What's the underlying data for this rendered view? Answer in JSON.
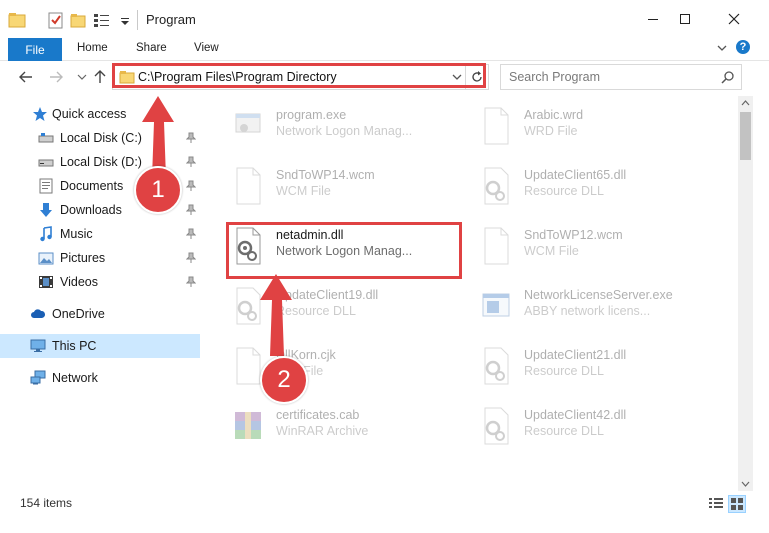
{
  "window": {
    "title": "Program"
  },
  "ribbon": {
    "tabs": [
      {
        "label": "File"
      },
      {
        "label": "Home"
      },
      {
        "label": "Share"
      },
      {
        "label": "View"
      }
    ]
  },
  "address": {
    "path": "C:\\Program Files\\Program Directory"
  },
  "search": {
    "placeholder": "Search Program"
  },
  "sidebar": {
    "items": [
      {
        "label": "Quick access",
        "icon": "star-icon"
      },
      {
        "label": "Local Disk (C:)",
        "icon": "drive-icon"
      },
      {
        "label": "Local Disk (D:)",
        "icon": "drive-icon"
      },
      {
        "label": "Documents",
        "icon": "documents-icon"
      },
      {
        "label": "Downloads",
        "icon": "download-icon"
      },
      {
        "label": "Music",
        "icon": "music-icon"
      },
      {
        "label": "Pictures",
        "icon": "pictures-icon"
      },
      {
        "label": "Videos",
        "icon": "videos-icon"
      },
      {
        "label": "OneDrive",
        "icon": "cloud-icon"
      },
      {
        "label": "This PC",
        "icon": "computer-icon"
      },
      {
        "label": "Network",
        "icon": "network-icon"
      }
    ]
  },
  "files": [
    {
      "name": "program.exe",
      "desc": "Network Logon Manag...",
      "icon": "exe-icon"
    },
    {
      "name": "Arabic.wrd",
      "desc": "WRD File",
      "icon": "blank-file-icon"
    },
    {
      "name": "SndToWP14.wcm",
      "desc": "WCM File",
      "icon": "blank-file-icon"
    },
    {
      "name": "UpdateClient65.dll",
      "desc": "Resource DLL",
      "icon": "dll-icon"
    },
    {
      "name": "netadmin.dll",
      "desc": "Network Logon Manag...",
      "icon": "dll-icon"
    },
    {
      "name": "SndToWP12.wcm",
      "desc": "WCM File",
      "icon": "blank-file-icon"
    },
    {
      "name": "UpdateClient19.dll",
      "desc": "Resource DLL",
      "icon": "dll-icon"
    },
    {
      "name": "NetworkLicenseServer.exe",
      "desc": "ABBY network licens...",
      "icon": "app-window-icon"
    },
    {
      "name": "DllKorn.cjk",
      "desc": "CJK File",
      "icon": "blank-file-icon"
    },
    {
      "name": "UpdateClient21.dll",
      "desc": "Resource DLL",
      "icon": "dll-icon"
    },
    {
      "name": "certificates.cab",
      "desc": "WinRAR Archive",
      "icon": "archive-icon"
    },
    {
      "name": "UpdateClient42.dll",
      "desc": "Resource DLL",
      "icon": "dll-icon"
    }
  ],
  "status": {
    "items_count": "154 items"
  },
  "callouts": [
    {
      "label": "1"
    },
    {
      "label": "2"
    }
  ],
  "colors": {
    "accent": "#1979ca",
    "highlight": "#e04243",
    "selection": "#cce8ff"
  }
}
